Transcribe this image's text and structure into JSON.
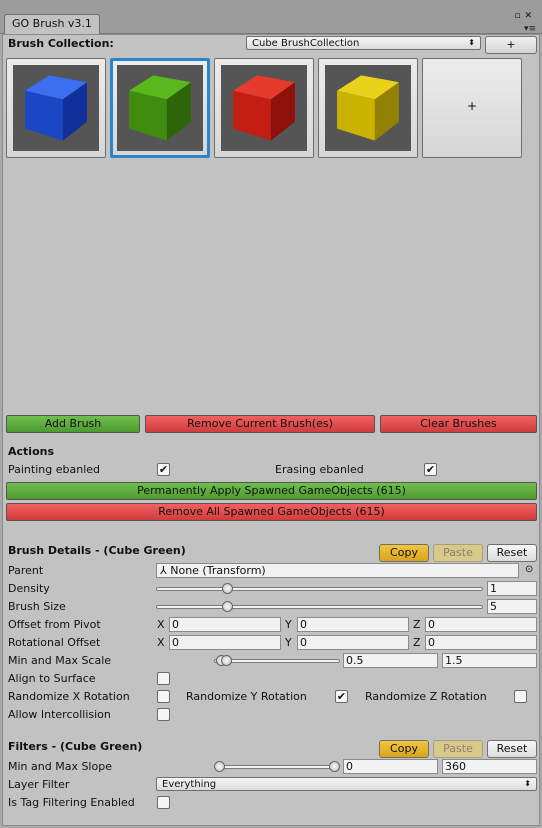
{
  "window": {
    "tab_title": "GO Brush v3.1"
  },
  "collection": {
    "label": "Brush Collection:",
    "selected": "Cube BrushCollection",
    "add_label": "+",
    "brushes": [
      {
        "name": "Cube Blue",
        "color": "#1b47c4"
      },
      {
        "name": "Cube Green",
        "color": "#3f8c10"
      },
      {
        "name": "Cube Red",
        "color": "#c41e12"
      },
      {
        "name": "Cube Yellow",
        "color": "#c9b200"
      }
    ],
    "new_tile_label": "+"
  },
  "brush_buttons": {
    "add": "Add Brush",
    "remove_current": "Remove Current Brush(es)",
    "clear": "Clear Brushes"
  },
  "actions": {
    "title": "Actions",
    "painting_label": "Painting ebanled",
    "painting_checked": true,
    "erasing_label": "Erasing ebanled",
    "erasing_checked": true,
    "apply_label": "Permanently Apply Spawned GameObjects (615)",
    "remove_all_label": "Remove All Spawned GameObjects (615)"
  },
  "details": {
    "title": "Brush Details - (Cube Green)",
    "copy": "Copy",
    "paste": "Paste",
    "reset": "Reset",
    "parent_label": "Parent",
    "parent_value": "None (Transform)",
    "density_label": "Density",
    "density_value": "1",
    "density_fraction": 0.21,
    "size_label": "Brush Size",
    "size_value": "5",
    "size_fraction": 0.21,
    "offset_pivot_label": "Offset from Pivot",
    "rot_offset_label": "Rotational Offset",
    "axis_x": "X",
    "axis_y": "Y",
    "axis_z": "Z",
    "offset_pivot": {
      "x": "0",
      "y": "0",
      "z": "0"
    },
    "rot_offset": {
      "x": "0",
      "y": "0",
      "z": "0"
    },
    "scale_label": "Min and Max Scale",
    "scale_min": "0.5",
    "scale_max": "1.5",
    "align_label": "Align to Surface",
    "align_checked": false,
    "rand_x_label": "Randomize X Rotation",
    "rand_x_checked": false,
    "rand_y_label": "Randomize Y Rotation",
    "rand_y_checked": true,
    "rand_z_label": "Randomize Z Rotation",
    "rand_z_checked": false,
    "intercollision_label": "Allow Intercollision",
    "intercollision_checked": false
  },
  "filters": {
    "title": "Filters - (Cube Green)",
    "copy": "Copy",
    "paste": "Paste",
    "reset": "Reset",
    "slope_label": "Min and Max Slope",
    "slope_min": "0",
    "slope_max": "360",
    "layer_label": "Layer Filter",
    "layer_value": "Everything",
    "tag_label": "Is Tag Filtering Enabled",
    "tag_checked": false
  }
}
